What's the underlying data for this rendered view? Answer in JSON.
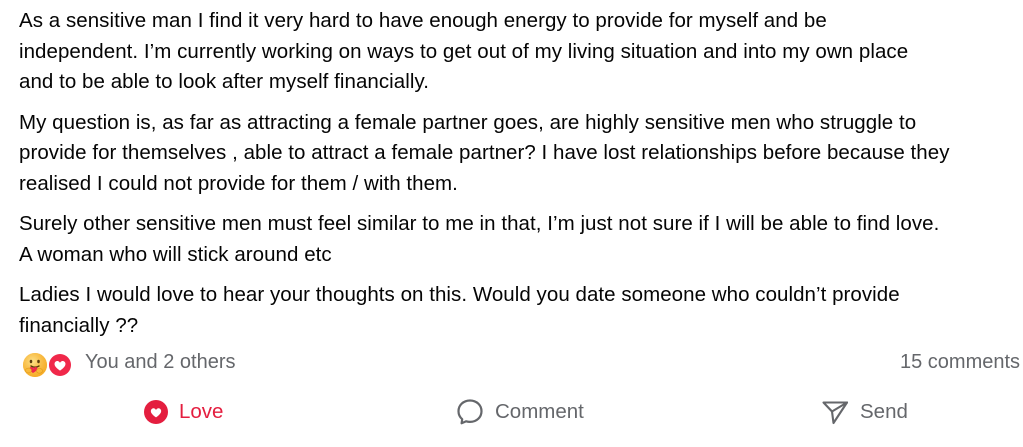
{
  "post": {
    "paragraphs": [
      {
        "lines": [
          "As a sensitive man I find it very hard to have enough energy to provide for myself and be",
          "independent. I’m currently working on ways to get out of my living situation and into my own place",
          "and to be able to look after myself financially."
        ]
      },
      {
        "lines": [
          "My question is, as far as attracting a female partner goes, are highly sensitive men who struggle to",
          "provide for themselves , able to attract a female partner? I have lost relationships before because they",
          "realised I could not provide for them / with them."
        ]
      },
      {
        "lines": [
          "Surely other sensitive men must feel similar to me in that, I’m just not sure if I will be able to find love.",
          "A woman who will stick around etc"
        ]
      },
      {
        "lines": [
          "Ladies I would love to hear your thoughts on this. Would you date someone who couldn’t provide",
          "financially ??"
        ]
      }
    ]
  },
  "reactions": {
    "icons": [
      "care-icon",
      "love-icon"
    ],
    "summary": "You and 2 others",
    "comments_count": "15 comments"
  },
  "actions": {
    "love": {
      "label": "Love",
      "icon": "heart-filled-icon",
      "color": "#e41e3f"
    },
    "comment": {
      "label": "Comment",
      "icon": "comment-bubble-icon"
    },
    "send": {
      "label": "Send",
      "icon": "send-icon"
    }
  },
  "colors": {
    "text": "#050505",
    "secondary": "#65676b",
    "love_red": "#e41e3f",
    "care_yellow": "#f7b125"
  }
}
